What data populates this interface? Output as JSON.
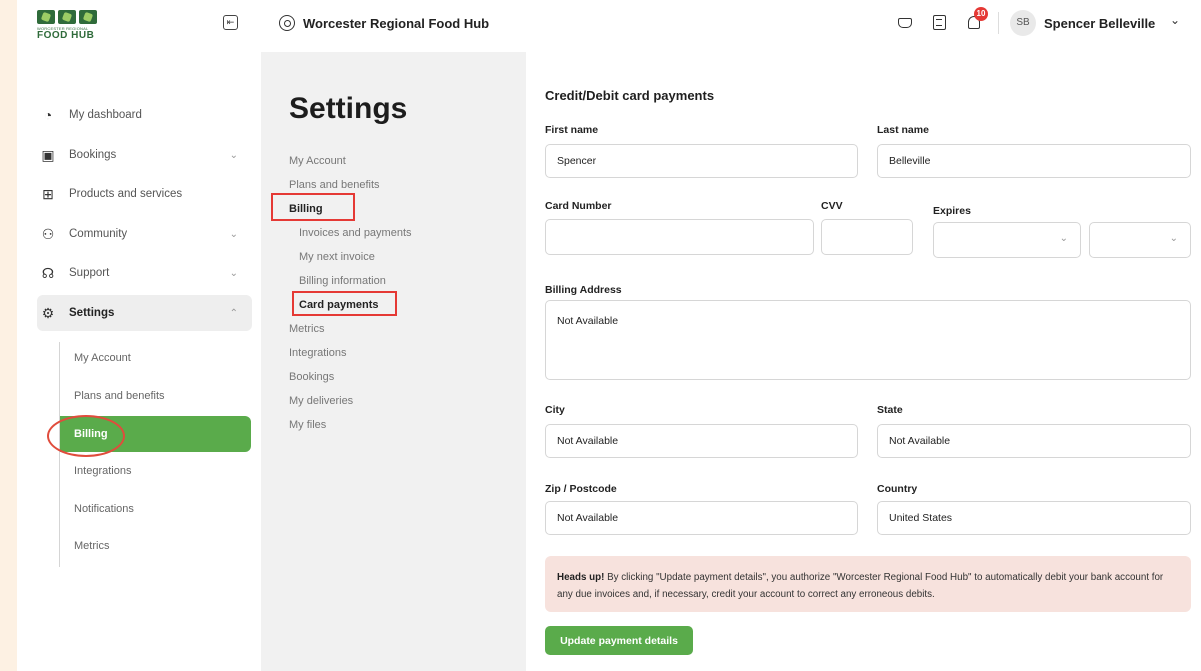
{
  "header": {
    "logo_line1": "WORCESTER REGIONAL",
    "logo_line2": "FOOD HUB",
    "hub_name": "Worcester Regional Food Hub",
    "notification_count": "10",
    "user_initials": "SB",
    "user_name": "Spencer Belleville",
    "icons": [
      "collapse-sidebar-icon",
      "location-pin-icon",
      "basket-icon",
      "document-icon",
      "bell-icon",
      "chevron-down-icon"
    ]
  },
  "sidebar": {
    "items": [
      {
        "label": "My dashboard",
        "icon": "dashboard-icon"
      },
      {
        "label": "Bookings",
        "icon": "calendar-icon"
      },
      {
        "label": "Products and services",
        "icon": "products-icon"
      },
      {
        "label": "Community",
        "icon": "community-icon"
      },
      {
        "label": "Support",
        "icon": "support-icon"
      },
      {
        "label": "Settings",
        "icon": "gear-icon"
      }
    ],
    "settings_sub": [
      "My Account",
      "Plans and benefits",
      "Billing",
      "Integrations",
      "Notifications",
      "Metrics"
    ]
  },
  "settings_panel": {
    "title": "Settings",
    "links": [
      "My Account",
      "Plans and benefits",
      "Billing",
      "Invoices and payments",
      "My next invoice",
      "Billing information",
      "Card payments",
      "Metrics",
      "Integrations",
      "Bookings",
      "My deliveries",
      "My files"
    ]
  },
  "form": {
    "heading": "Credit/Debit card payments",
    "first_name_label": "First name",
    "first_name_value": "Spencer",
    "last_name_label": "Last name",
    "last_name_value": "Belleville",
    "card_number_label": "Card Number",
    "cvv_label": "CVV",
    "expires_label": "Expires",
    "billing_address_label": "Billing Address",
    "billing_address_value": "Not Available",
    "city_label": "City",
    "city_value": "Not Available",
    "state_label": "State",
    "state_value": "Not Available",
    "zip_label": "Zip / Postcode",
    "zip_value": "Not Available",
    "country_label": "Country",
    "country_value": "United States"
  },
  "notice": {
    "strong": "Heads up!",
    "text": " By clicking \"Update payment details\", you authorize \"Worcester Regional Food Hub\" to automatically debit your bank account for any due invoices and, if necessary, credit your account to correct any erroneous debits."
  },
  "update_button": "Update payment details",
  "colors": {
    "accent_green": "#5aab4b",
    "annotation_red": "#e53935",
    "notice_bg": "#f7e2dd",
    "page_margin": "#fdf1e3"
  }
}
